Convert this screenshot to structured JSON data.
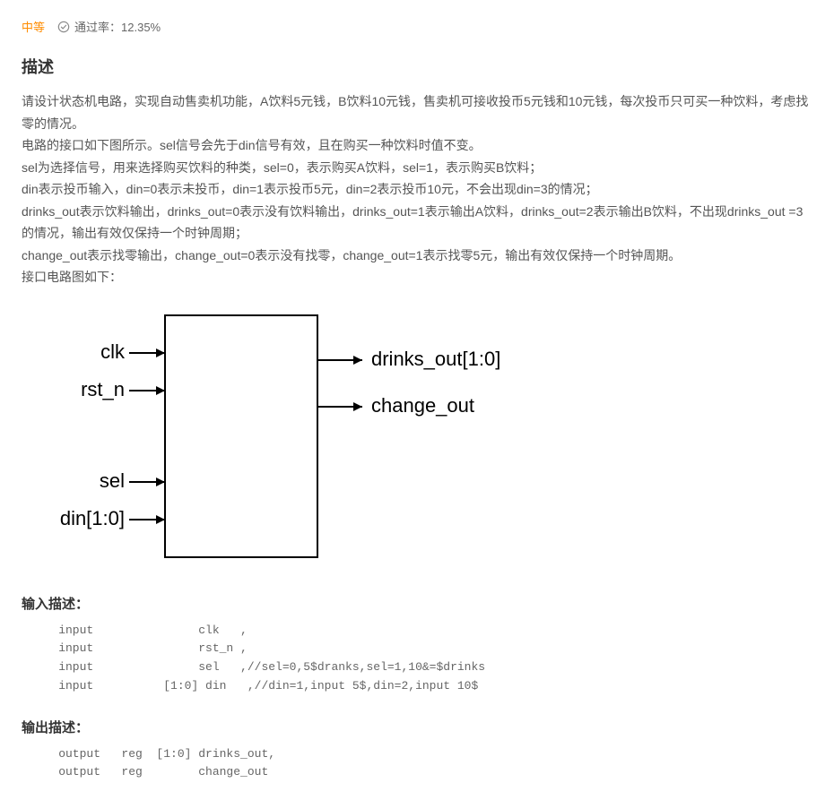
{
  "header": {
    "difficulty": "中等",
    "pass_rate_label": "通过率：12.35%"
  },
  "section_title": "描述",
  "description": {
    "p1": "请设计状态机电路，实现自动售卖机功能，A饮料5元钱，B饮料10元钱，售卖机可接收投币5元钱和10元钱，每次投币只可买一种饮料，考虑找零的情况。",
    "p2": "电路的接口如下图所示。sel信号会先于din信号有效，且在购买一种饮料时值不变。",
    "p3": "sel为选择信号，用来选择购买饮料的种类，sel=0，表示购买A饮料，sel=1，表示购买B饮料；",
    "p4": "din表示投币输入，din=0表示未投币，din=1表示投币5元，din=2表示投币10元，不会出现din=3的情况；",
    "p5": "drinks_out表示饮料输出，drinks_out=0表示没有饮料输出，drinks_out=1表示输出A饮料，drinks_out=2表示输出B饮料，不出现drinks_out =3的情况，输出有效仅保持一个时钟周期；",
    "p6": "change_out表示找零输出，change_out=0表示没有找零，change_out=1表示找零5元，输出有效仅保持一个时钟周期。",
    "p7": "接口电路图如下："
  },
  "diagram": {
    "inputs": [
      "clk",
      "rst_n",
      "sel",
      "din[1:0]"
    ],
    "outputs": [
      "drinks_out[1:0]",
      "change_out"
    ]
  },
  "input_section": {
    "title": "输入描述：",
    "lines": "    input               clk   ,\n    input               rst_n ,\n    input               sel   ,//sel=0,5$dranks,sel=1,10&=$drinks\n    input          [1:0] din   ,//din=1,input 5$,din=2,input 10$"
  },
  "output_section": {
    "title": "输出描述：",
    "lines": "    output   reg  [1:0] drinks_out,\n    output   reg        change_out"
  }
}
